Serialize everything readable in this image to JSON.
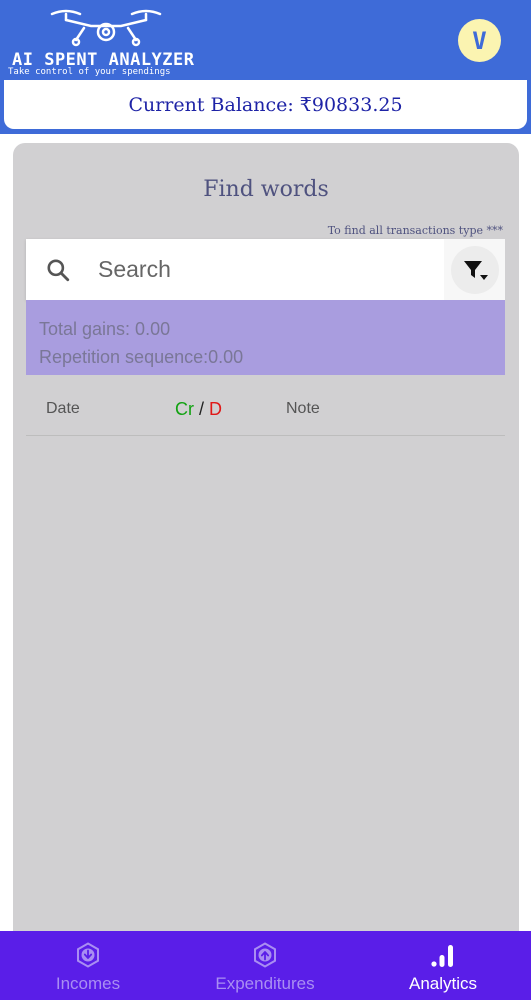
{
  "header": {
    "logo_title": "AI SPENT ANALYZER",
    "logo_tagline": "Take control of your spendings",
    "avatar_letter": "V"
  },
  "balance": {
    "text": "Current Balance: ₹90833.25"
  },
  "find": {
    "title": "Find words",
    "hint": "To find all transactions type ***",
    "search_placeholder": "Search"
  },
  "stats": {
    "total_gains": "Total gains: 0.00",
    "repetition": "Repetition sequence:0.00"
  },
  "table": {
    "col_date": "Date",
    "col_cr": "Cr",
    "col_sep": "/",
    "col_d": "D",
    "col_note": "Note"
  },
  "nav": {
    "items": [
      {
        "label": "Incomes",
        "icon": "download-hex-icon",
        "active": false
      },
      {
        "label": "Expenditures",
        "icon": "upload-hex-icon",
        "active": false
      },
      {
        "label": "Analytics",
        "icon": "bar-chart-icon",
        "active": true
      }
    ]
  },
  "colors": {
    "header_blue": "#3e6bd8",
    "balance_text": "#1e23a6",
    "nav_purple": "#5a1ee8",
    "stats_bg": "#a99ddf",
    "credit_green": "#12a212",
    "debit_red": "#e01818"
  }
}
